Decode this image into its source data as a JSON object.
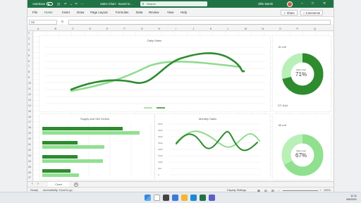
{
  "titlebar": {
    "autosave": "AutoSave",
    "filename": "Sales Chart - Saved to...",
    "search_placeholder": "Search",
    "user": "Ollie Marsh"
  },
  "ribbon": {
    "tabs": [
      "File",
      "Home",
      "Insert",
      "Draw",
      "Page Layout",
      "Formulas",
      "Data",
      "Review",
      "View",
      "Help"
    ],
    "share_label": "Share",
    "comments_label": "Comments"
  },
  "formula_bar": {
    "namebox": "A1",
    "fx": "fx",
    "value": ""
  },
  "columns": [
    "A",
    "B",
    "C",
    "D",
    "E",
    "F",
    "G",
    "H",
    "I",
    "J",
    "K",
    "L",
    "M",
    "N",
    "O",
    "P",
    "Q"
  ],
  "rows": [
    "1",
    "2",
    "3",
    "4",
    "5",
    "6",
    "7",
    "8",
    "9",
    "10",
    "11",
    "12",
    "13",
    "14",
    "15",
    "16",
    "17",
    "18",
    "19",
    "20",
    "21",
    "22",
    "23",
    "24",
    "25",
    "26",
    "27"
  ],
  "charts": {
    "daily": {
      "title": "Daily Sales"
    },
    "supply": {
      "title": "Supply and Sell Orders"
    },
    "monthly": {
      "title": "Monthly Sales",
      "y_ticks": [
        "4000",
        "3500",
        "3000",
        "2500",
        "2000",
        "1500",
        "1000",
        "500",
        "0"
      ]
    },
    "donut1": {
      "top_label": "81 Left",
      "center_caption": "Sales Goal",
      "percent": "71%",
      "bottom_label": "271 Sold",
      "fraction": 0.71
    },
    "donut2": {
      "top_label": "55 Left",
      "center_caption": "Sales Goal",
      "percent": "67%",
      "fraction": 0.67
    }
  },
  "sheet_tab": "Chart",
  "statusbar": {
    "ready": "Ready",
    "accessibility": "Accessibility: Good to go",
    "display": "Display Settings",
    "zoom": "100%"
  },
  "clock": {
    "time": "11:11",
    "date": "9/6/2021"
  },
  "colors": {
    "excel_green": "#217346",
    "dark_green": "#2e8b2e",
    "light_green": "#90e090"
  }
}
